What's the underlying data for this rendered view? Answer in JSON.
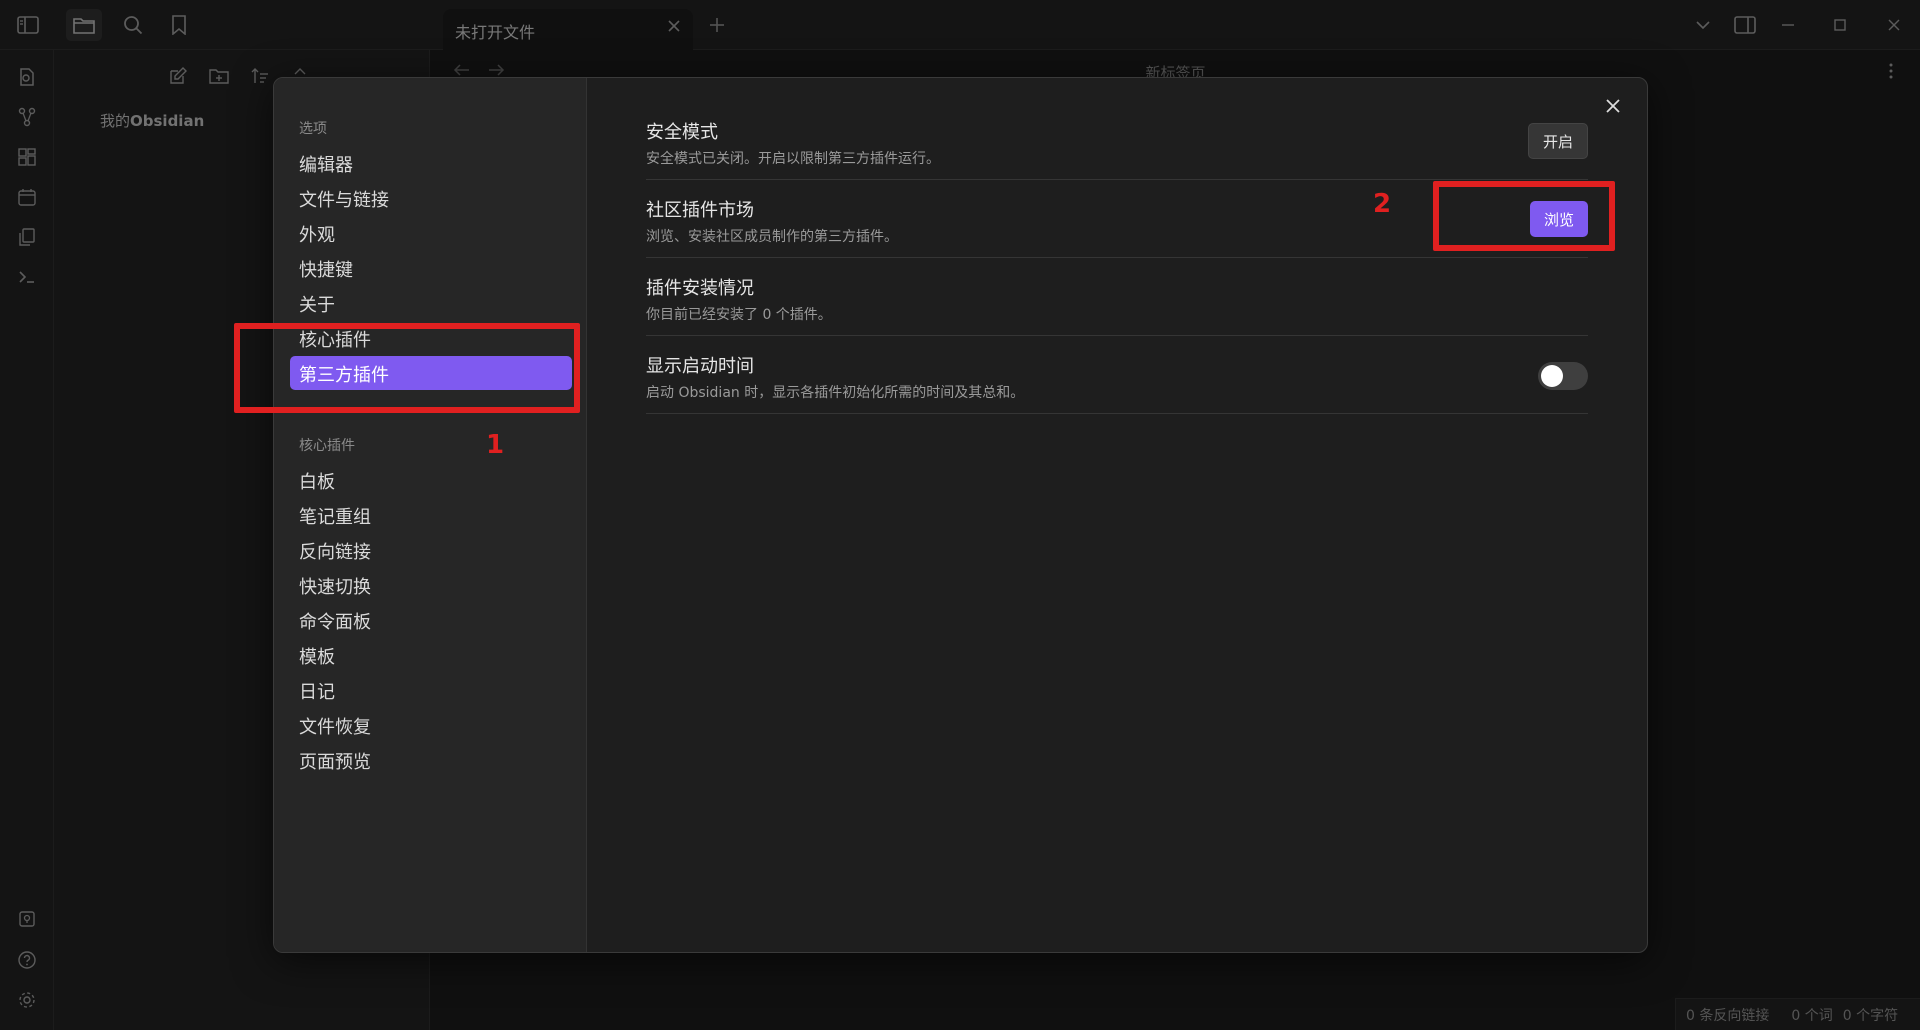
{
  "tab": {
    "title": "未打开文件"
  },
  "main": {
    "title": "新标签页"
  },
  "left_pane": {
    "vault_prefix": "我的",
    "vault_name": "Obsidian"
  },
  "status_bar": {
    "backlinks": "0 条反向链接",
    "words": "0 个词",
    "chars": "0 个字符"
  },
  "settings": {
    "options_group_label": "选项",
    "options": [
      "编辑器",
      "文件与链接",
      "外观",
      "快捷键",
      "关于",
      "核心插件",
      "第三方插件"
    ],
    "active_option": "第三方插件",
    "core_group_label": "核心插件",
    "core_plugins": [
      "白板",
      "笔记重组",
      "反向链接",
      "快速切换",
      "命令面板",
      "模板",
      "日记",
      "文件恢复",
      "页面预览"
    ],
    "rows": [
      {
        "name": "安全模式",
        "desc": "安全模式已关闭。开启以限制第三方插件运行。",
        "button": "开启"
      },
      {
        "name": "社区插件市场",
        "desc": "浏览、安装社区成员制作的第三方插件。",
        "button": "浏览"
      },
      {
        "name": "插件安装情况",
        "desc": "你目前已经安装了 0 个插件。"
      },
      {
        "name": "显示启动时间",
        "desc": "启动 Obsidian 时，显示各插件初始化所需的时间及其总和。",
        "toggle_on": false
      }
    ]
  },
  "annotations": {
    "label_1": "1",
    "label_2": "2"
  },
  "colors": {
    "accent": "#7f5af0",
    "annotation": "#e02020"
  }
}
